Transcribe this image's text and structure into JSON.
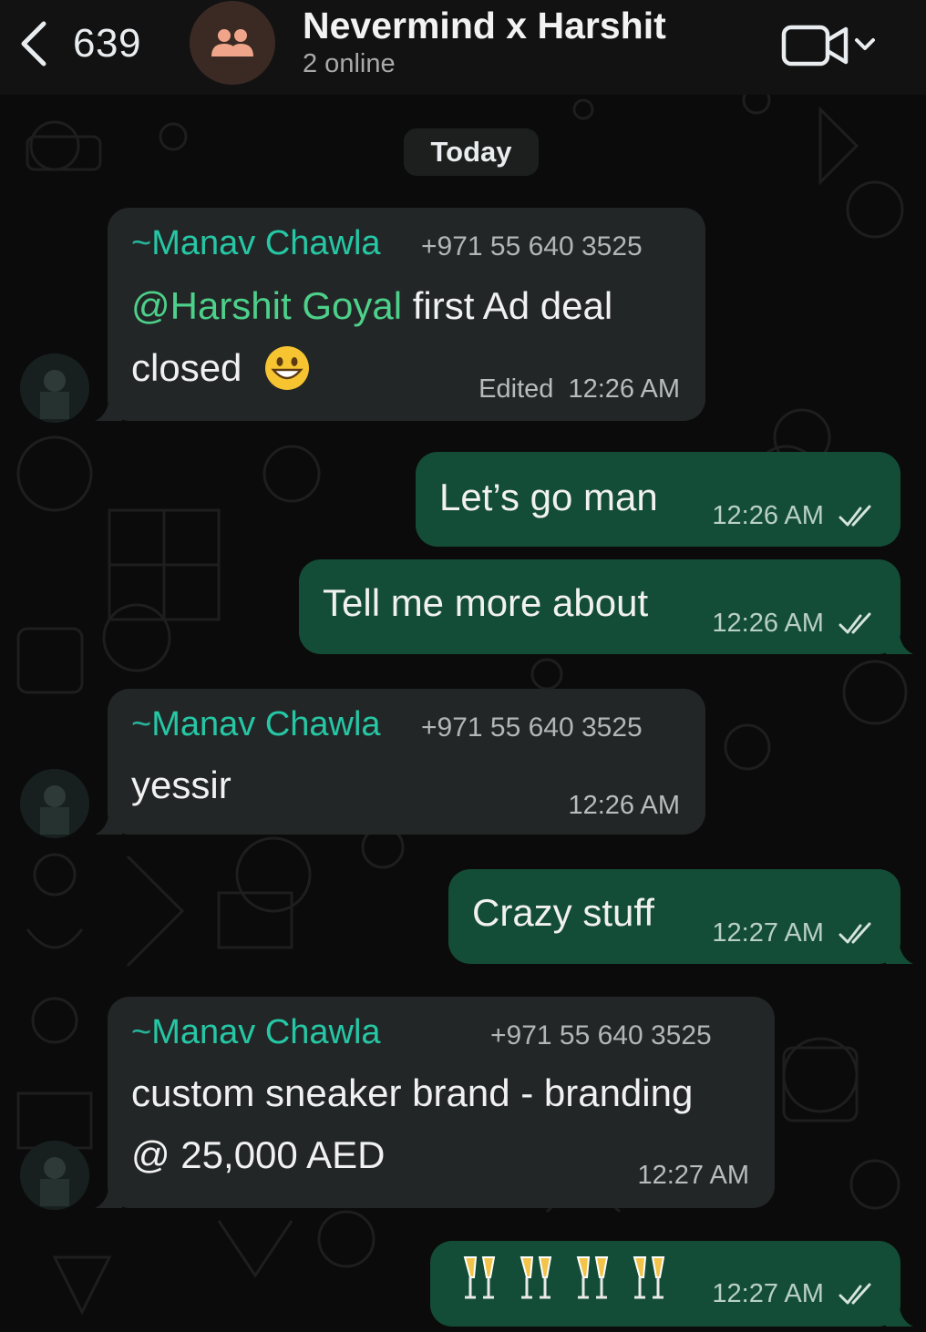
{
  "header": {
    "back_count": "639",
    "title": "Nevermind x Harshit",
    "subtitle": "2 online"
  },
  "date_chip": "Today",
  "messages": [
    {
      "direction": "incoming",
      "sender_prefix": "~",
      "sender": "Manav Chawla",
      "phone": "+971 55 640 3525",
      "mention": "@Harshit Goyal",
      "line1_rest": " first Ad deal",
      "line2": "closed",
      "emoji": "grinning-face",
      "edited": "Edited",
      "time": "12:26 AM"
    },
    {
      "direction": "outgoing",
      "text": "Let’s go man",
      "time": "12:26 AM",
      "status": "read"
    },
    {
      "direction": "outgoing",
      "text": "Tell me more about",
      "time": "12:26 AM",
      "status": "read"
    },
    {
      "direction": "incoming",
      "sender_prefix": "~",
      "sender": "Manav Chawla",
      "phone": "+971 55 640 3525",
      "text": "yessir",
      "time": "12:26 AM"
    },
    {
      "direction": "outgoing",
      "text": "Crazy stuff",
      "time": "12:27 AM",
      "status": "read"
    },
    {
      "direction": "incoming",
      "sender_prefix": "~",
      "sender": "Manav Chawla",
      "phone": "+971 55 640 3525",
      "line1": "custom sneaker brand - branding",
      "line2": "@ 25,000 AED",
      "time": "12:27 AM"
    },
    {
      "direction": "outgoing",
      "emojis": [
        "clinking-glasses",
        "clinking-glasses",
        "clinking-glasses",
        "clinking-glasses"
      ],
      "time": "12:27 AM",
      "status": "read"
    }
  ],
  "colors": {
    "incoming_bubble": "#232626",
    "outgoing_bubble": "#144d37",
    "sender_name": "#25c7a5",
    "mention": "#4cd08a"
  },
  "icons": [
    "chevron-left-icon",
    "group-icon",
    "video-call-icon",
    "chevron-down-icon",
    "double-check-icon",
    "grinning-face-emoji",
    "clinking-glasses-emoji"
  ]
}
